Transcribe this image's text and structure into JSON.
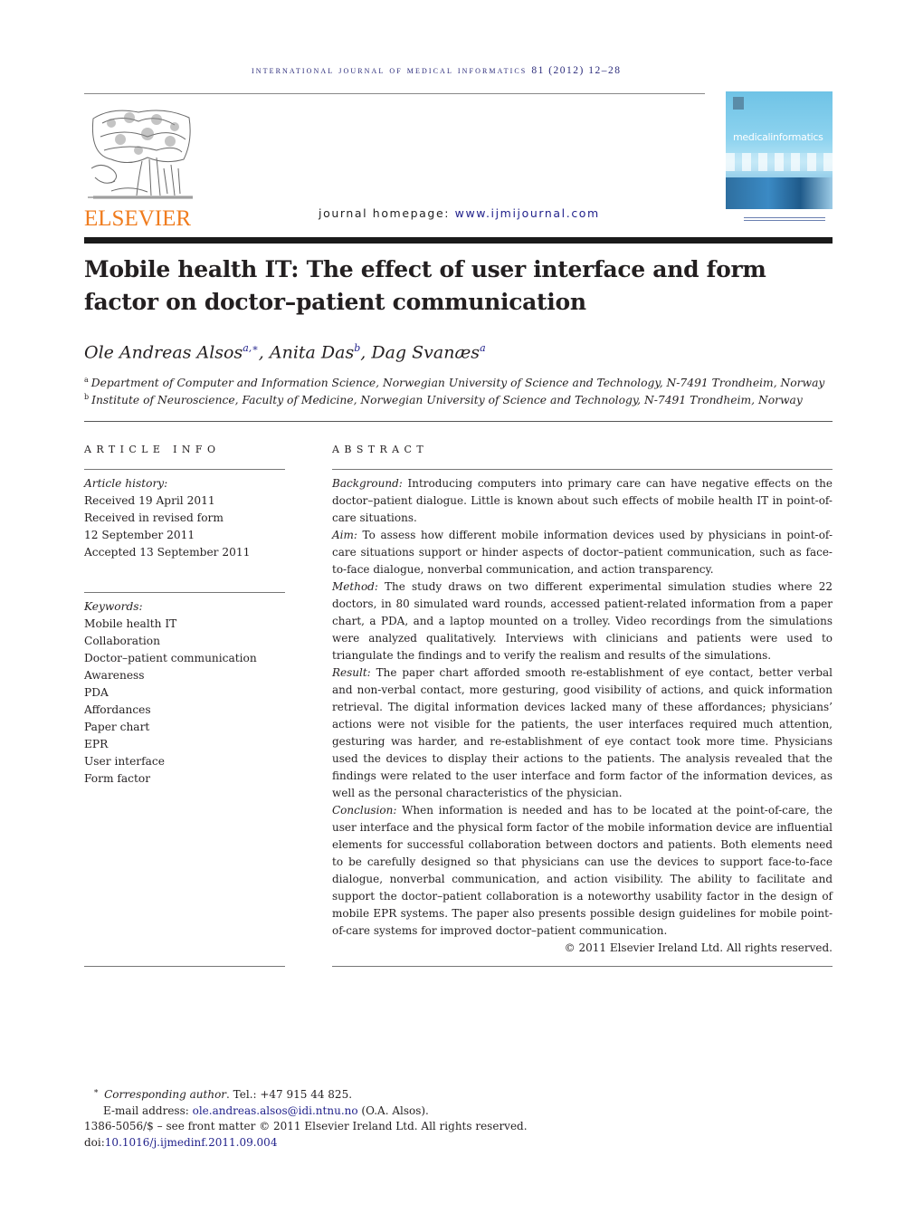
{
  "header": {
    "running_head": "international journal of medical informatics",
    "citation": "81 (2012) 12–28",
    "publisher_logo": "ELSEVIER",
    "homepage_label": "journal homepage:",
    "homepage_url": "www.ijmijournal.com",
    "cover_title": "medicalinformatics"
  },
  "article": {
    "title": "Mobile health IT: The effect of user interface and form factor on doctor–patient communication",
    "authors": [
      {
        "name": "Ole Andreas Alsos",
        "sup": "a,∗"
      },
      {
        "name": "Anita Das",
        "sup": "b"
      },
      {
        "name": "Dag Svanæs",
        "sup": "a"
      }
    ],
    "affiliations": [
      {
        "mark": "a",
        "text": "Department of Computer and Information Science, Norwegian University of Science and Technology, N-7491 Trondheim, Norway"
      },
      {
        "mark": "b",
        "text": "Institute of Neuroscience, Faculty of Medicine, Norwegian University of Science and Technology, N-7491 Trondheim, Norway"
      }
    ]
  },
  "article_info": {
    "heading": "ARTICLE INFO",
    "history_label": "Article history:",
    "history": [
      "Received 19 April 2011",
      "Received in revised form",
      "12 September 2011",
      "Accepted 13 September 2011"
    ],
    "keywords_label": "Keywords:",
    "keywords": [
      "Mobile health IT",
      "Collaboration",
      "Doctor–patient communication",
      "Awareness",
      "PDA",
      "Affordances",
      "Paper chart",
      "EPR",
      "User interface",
      "Form factor"
    ]
  },
  "abstract": {
    "heading": "ABSTRACT",
    "sections": [
      {
        "label": "Background:",
        "text": " Introducing computers into primary care can have negative effects on the doctor–patient dialogue. Little is known about such effects of mobile health IT in point-of-care situations."
      },
      {
        "label": "Aim:",
        "text": " To assess how different mobile information devices used by physicians in point-of-care situations support or hinder aspects of doctor–patient communication, such as face-to-face dialogue, nonverbal communication, and action transparency."
      },
      {
        "label": "Method:",
        "text": " The study draws on two different experimental simulation studies where 22 doctors, in 80 simulated ward rounds, accessed patient-related information from a paper chart, a PDA, and a laptop mounted on a trolley. Video recordings from the simulations were analyzed qualitatively. Interviews with clinicians and patients were used to triangulate the findings and to verify the realism and results of the simulations."
      },
      {
        "label": "Result:",
        "text": " The paper chart afforded smooth re-establishment of eye contact, better verbal and non-verbal contact, more gesturing, good visibility of actions, and quick information retrieval. The digital information devices lacked many of these affordances; physicians’ actions were not visible for the patients, the user interfaces required much attention, gesturing was harder, and re-establishment of eye contact took more time. Physicians used the devices to display their actions to the patients. The analysis revealed that the findings were related to the user interface and form factor of the information devices, as well as the personal characteristics of the physician."
      },
      {
        "label": "Conclusion:",
        "text": " When information is needed and has to be located at the point-of-care, the user interface and the physical form factor of the mobile information device are influential elements for successful collaboration between doctors and patients. Both elements need to be carefully designed so that physicians can use the devices to support face-to-face dialogue, nonverbal communication, and action visibility. The ability to facilitate and support the doctor–patient collaboration is a noteworthy usability factor in the design of mobile EPR systems. The paper also presents possible design guidelines for mobile point-of-care systems for improved doctor–patient communication."
      }
    ],
    "copyright": "© 2011 Elsevier Ireland Ltd. All rights reserved."
  },
  "footnotes": {
    "star": "∗",
    "corresponding_label": "Corresponding author",
    "tel": ". Tel.: +47 915 44 825.",
    "email_label": "E-mail address: ",
    "email": "ole.andreas.alsos@idi.ntnu.no",
    "email_owner": " (O.A. Alsos).",
    "issn_line": "1386-5056/$ – see front matter © 2011 Elsevier Ireland Ltd. All rights reserved.",
    "doi_label": "doi:",
    "doi": "10.1016/j.ijmedinf.2011.09.004"
  },
  "colors": {
    "link": "#1f1f8a",
    "elsevier_orange": "#f07c1e",
    "text": "#231f20"
  }
}
